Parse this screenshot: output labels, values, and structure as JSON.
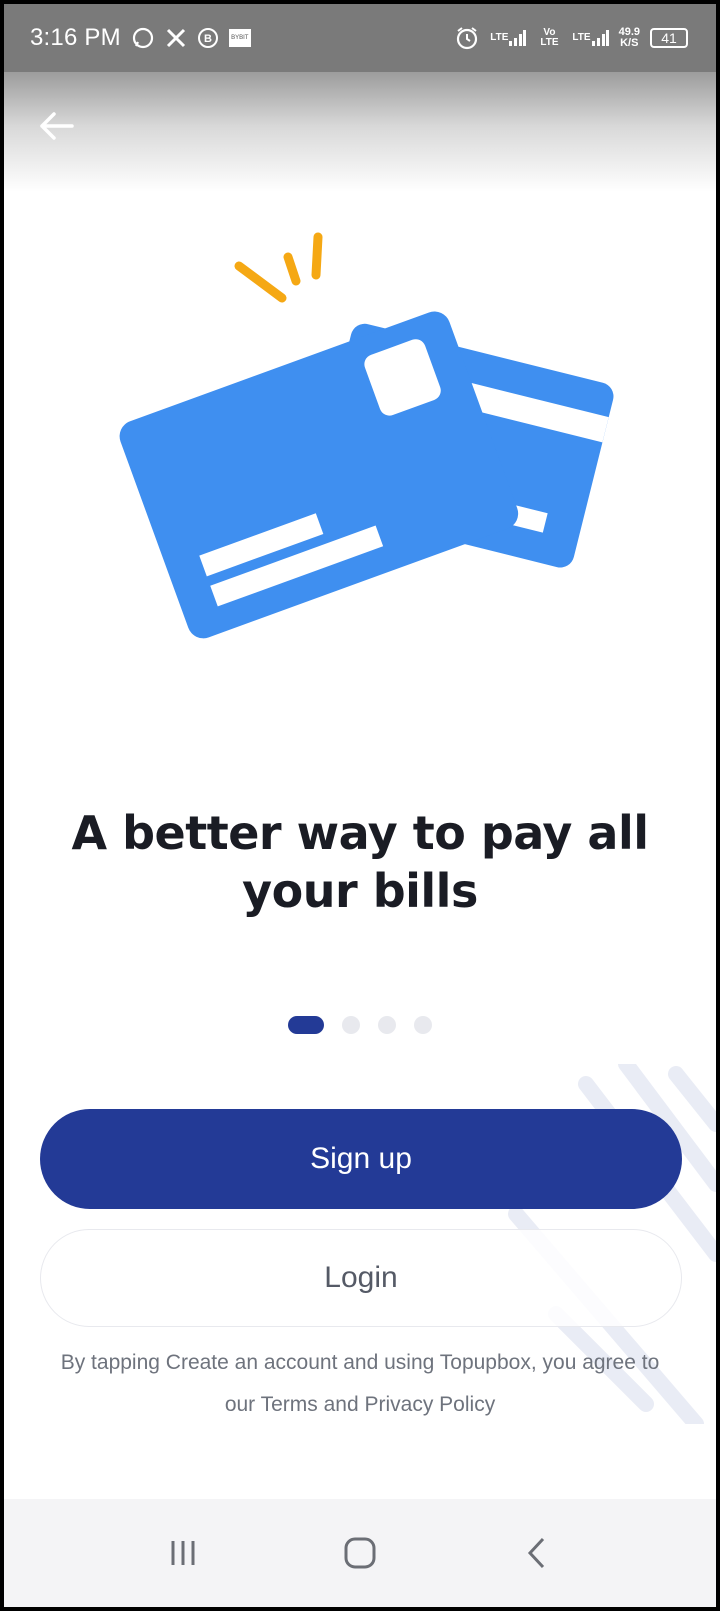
{
  "status_bar": {
    "time": "3:16 PM",
    "notification_icons": [
      "whatsapp-icon",
      "x-icon",
      "b-circle-icon",
      "bybit-icon"
    ],
    "bybit_label": "BYBIT",
    "lte1": "LTE",
    "volte": "Vo LTE",
    "lte2": "LTE",
    "net_speed_value": "49.9",
    "net_speed_unit": "K/S",
    "battery": "41"
  },
  "onboarding": {
    "headline": "A better way to pay all your bills",
    "page_count": 4,
    "active_page": 1
  },
  "actions": {
    "signup_label": "Sign up",
    "login_label": "Login"
  },
  "terms_text": "By tapping Create an account and using Topupbox, you agree to our Terms and Privacy Policy",
  "colors": {
    "primary": "#233a96",
    "card_blue": "#3f8ff0",
    "accent_orange": "#f5a814"
  }
}
